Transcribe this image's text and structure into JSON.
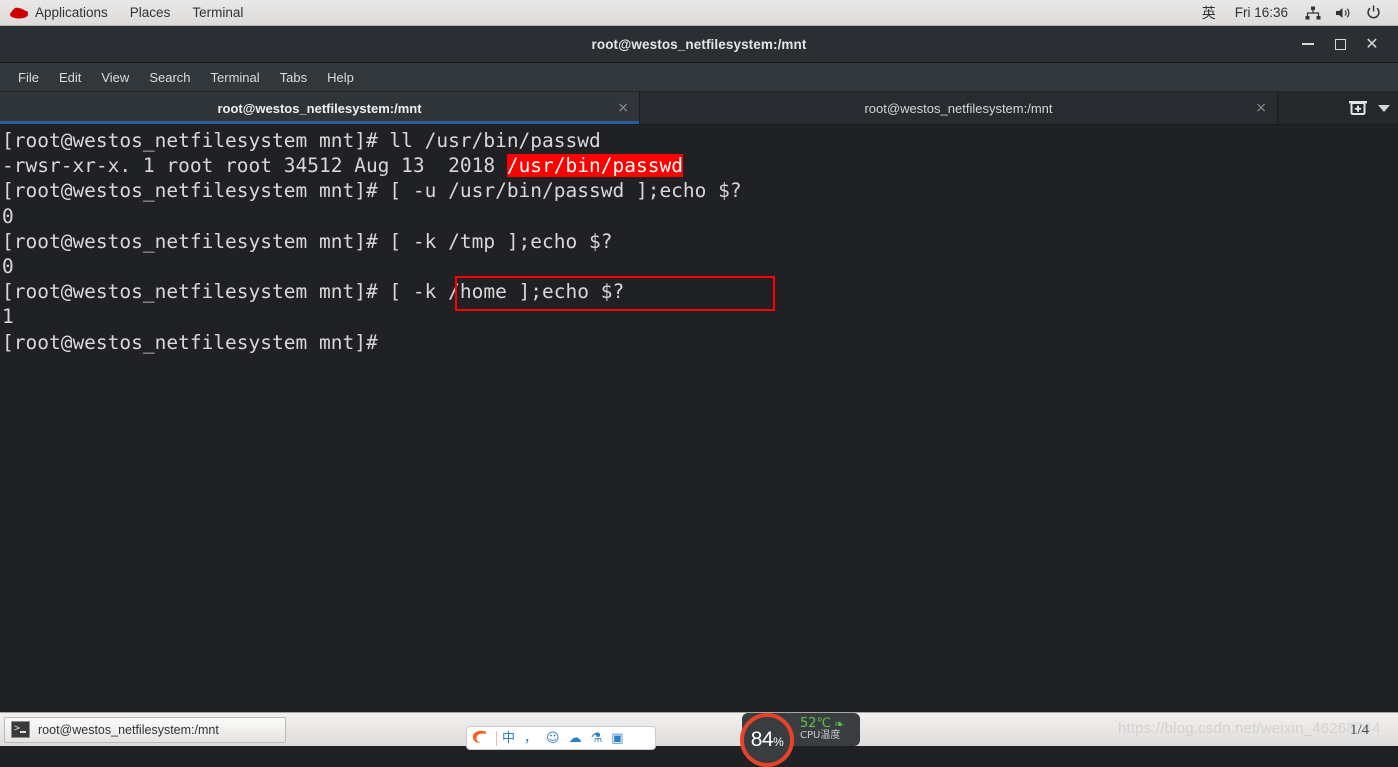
{
  "gnome_panel": {
    "logo_icon": "redhat-logo-icon",
    "menus": [
      {
        "label": "Applications"
      },
      {
        "label": "Places"
      },
      {
        "label": "Terminal"
      }
    ],
    "ime_indicator": "英",
    "clock": "Fri 16:36",
    "status_icons": [
      {
        "name": "network-icon",
        "glyph": "network"
      },
      {
        "name": "volume-icon",
        "glyph": "volume"
      },
      {
        "name": "power-icon",
        "glyph": "power"
      }
    ]
  },
  "window": {
    "title": "root@westos_netfilesystem:/mnt",
    "controls": {
      "minimize": "minimize-icon",
      "maximize": "maximize-icon",
      "close": "close-icon"
    }
  },
  "menubar": {
    "items": [
      {
        "label": "File"
      },
      {
        "label": "Edit"
      },
      {
        "label": "View"
      },
      {
        "label": "Search"
      },
      {
        "label": "Terminal"
      },
      {
        "label": "Tabs"
      },
      {
        "label": "Help"
      }
    ]
  },
  "tabs": [
    {
      "label": "root@westos_netfilesystem:/mnt",
      "active": true,
      "close_glyph": "×"
    },
    {
      "label": "root@westos_netfilesystem:/mnt",
      "active": false,
      "close_glyph": "×"
    }
  ],
  "tabbar_actions": {
    "new_tab_icon": "new-tab-icon",
    "tab_menu_icon": "chevron-down-icon"
  },
  "terminal": {
    "prompt": "[root@westos_netfilesystem mnt]# ",
    "lines": [
      {
        "id": "line-1",
        "segments": [
          {
            "text": "[root@westos_netfilesystem mnt]# ll /usr/bin/passwd",
            "style": "normal"
          }
        ]
      },
      {
        "id": "line-2",
        "segments": [
          {
            "text": "-rwsr-xr-x. 1 root root 34512 Aug 13  2018 ",
            "style": "normal"
          },
          {
            "text": "/usr/bin/passwd",
            "style": "highlight-red"
          }
        ]
      },
      {
        "id": "line-3",
        "segments": [
          {
            "text": "[root@westos_netfilesystem mnt]# [ -u /usr/bin/passwd ];echo $?",
            "style": "normal"
          }
        ]
      },
      {
        "id": "line-4",
        "segments": [
          {
            "text": "0",
            "style": "normal"
          }
        ]
      },
      {
        "id": "line-5",
        "segments": [
          {
            "text": "[root@westos_netfilesystem mnt]# [ -k /tmp ];echo $?",
            "style": "normal"
          }
        ]
      },
      {
        "id": "line-6",
        "segments": [
          {
            "text": "0",
            "style": "normal"
          }
        ]
      },
      {
        "id": "line-7",
        "segments": [
          {
            "text": "[root@westos_netfilesystem mnt]# [ -k /home ];echo $?",
            "style": "normal"
          }
        ]
      },
      {
        "id": "line-8",
        "segments": [
          {
            "text": "1",
            "style": "normal"
          }
        ]
      },
      {
        "id": "line-9",
        "segments": [
          {
            "text": "[root@westos_netfilesystem mnt]#",
            "style": "normal"
          }
        ]
      }
    ],
    "annotation": {
      "name": "red-highlight-box",
      "target_text": "[ -k /home ];echo $?",
      "color": "#ff0000"
    },
    "colors": {
      "background": "#1f2124",
      "foreground": "#d8d8d8",
      "setuid_highlight_bg": "#ff0000",
      "setuid_highlight_fg": "#ffffff"
    }
  },
  "taskbar": {
    "window_button": {
      "icon": "terminal-icon",
      "label": "root@westos_netfilesystem:/mnt"
    }
  },
  "ime_toolbar": {
    "logo_icon": "sogou-logo-icon",
    "icons": [
      {
        "name": "chinese-mode-icon",
        "glyph": "中"
      },
      {
        "name": "punctuation-icon",
        "glyph": "，"
      },
      {
        "name": "emoji-icon",
        "glyph": "☺"
      },
      {
        "name": "cloud-icon",
        "glyph": "☁"
      },
      {
        "name": "toolbox-icon",
        "glyph": "⚗"
      },
      {
        "name": "keyboard-icon",
        "glyph": "▣"
      }
    ]
  },
  "cpu_widget": {
    "usage_value": "84",
    "usage_unit": "%",
    "temperature": "52℃",
    "temperature_label": "CPU温度",
    "leaf_icon": "leaf-icon",
    "ring_color": "#e8432a",
    "temp_color": "#5ec24a"
  },
  "watermark": {
    "text": "https://blog.csdn.net/weixin_46268244"
  },
  "page_indicator": {
    "text": "1/4"
  }
}
